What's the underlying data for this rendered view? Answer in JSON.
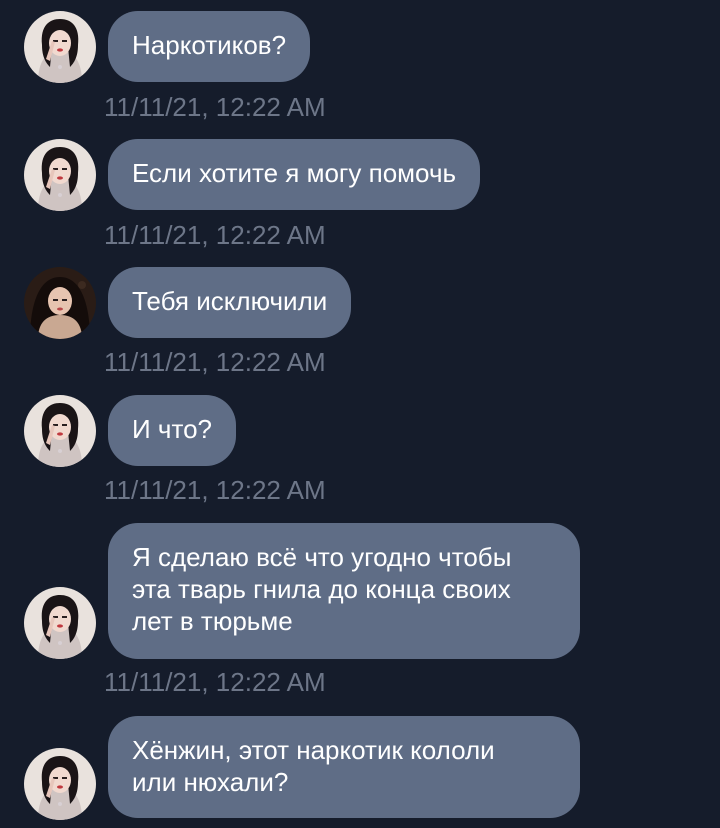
{
  "colors": {
    "background": "#151c2b",
    "bubble": "#5f6d86",
    "bubble_text": "#ffffff",
    "timestamp": "#6d7688"
  },
  "messages": [
    {
      "avatar": "avatar-girl-light-icon",
      "lines": [
        "Наркотиков?"
      ],
      "time": "11/11/21, 12:22 AM"
    },
    {
      "avatar": "avatar-girl-light-icon",
      "lines": [
        "Если хотите я могу помочь"
      ],
      "time": "11/11/21, 12:22 AM"
    },
    {
      "avatar": "avatar-girl-dark-icon",
      "lines": [
        "Тебя исключили"
      ],
      "time": "11/11/21, 12:22 AM"
    },
    {
      "avatar": "avatar-girl-light-icon",
      "lines": [
        "И что?"
      ],
      "time": "11/11/21, 12:22 AM"
    },
    {
      "avatar": "avatar-girl-light-icon",
      "lines": [
        "Я сделаю всё что угодно чтобы",
        "эта тварь гнила до конца своих",
        "лет в тюрьме"
      ],
      "time": "11/11/21, 12:22 AM"
    },
    {
      "avatar": "avatar-girl-light-icon",
      "lines": [
        "Хёнжин, этот наркотик кололи",
        "или нюхали?"
      ]
    }
  ]
}
